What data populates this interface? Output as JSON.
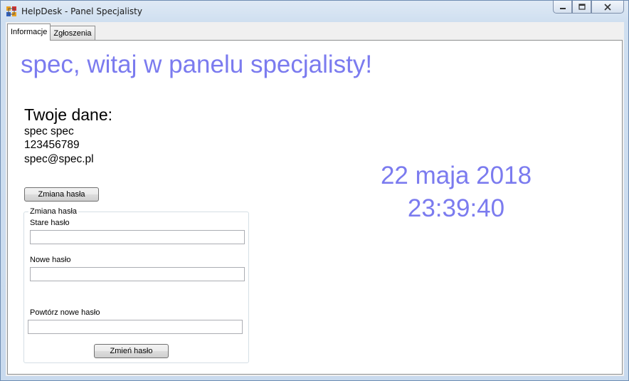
{
  "window": {
    "title": "HelpDesk - Panel Specjalisty",
    "icon": "app-icon",
    "controls": [
      "minimize-icon",
      "maximize-icon",
      "close-icon"
    ]
  },
  "tabs": [
    {
      "label": "Informacje",
      "active": true
    },
    {
      "label": "Zgłoszenia",
      "active": false
    }
  ],
  "main": {
    "welcome": "spec, witaj w panelu specjalisty!",
    "user_heading": "Twoje dane:",
    "user_name": "spec spec",
    "user_phone": "123456789",
    "user_email": "spec@spec.pl",
    "date": "22 maja 2018",
    "time": "23:39:40"
  },
  "change_password_button": "Zmiana hasła",
  "password_group": {
    "title": "Zmiana hasła",
    "old_label": "Stare hasło",
    "old_value": "",
    "new_label": "Nowe hasło",
    "new_value": "",
    "repeat_label": "Powtórz nowe hasło",
    "repeat_value": "",
    "submit_label": "Zmień hasło"
  },
  "colors": {
    "accent_text": "#7b7bef",
    "window_frame": "#c9daee"
  }
}
